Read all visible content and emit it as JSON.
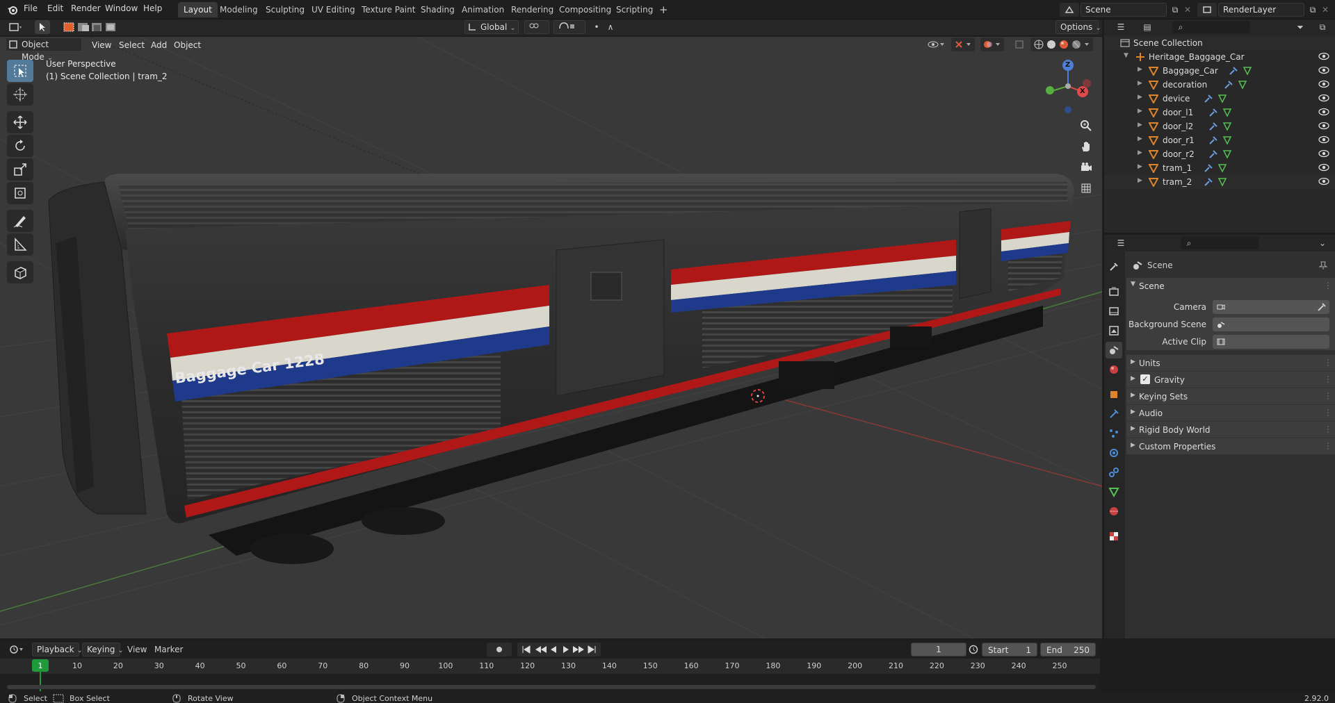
{
  "menus": {
    "file": "File",
    "edit": "Edit",
    "render": "Render",
    "window": "Window",
    "help": "Help"
  },
  "workspaces": [
    "Layout",
    "Modeling",
    "Sculpting",
    "UV Editing",
    "Texture Paint",
    "Shading",
    "Animation",
    "Rendering",
    "Compositing",
    "Scripting"
  ],
  "active_workspace": "Layout",
  "add_workspace": "+",
  "scene_name": "Scene",
  "render_layer": "RenderLayer",
  "toolbar": {
    "orientation": "Global",
    "options": "Options"
  },
  "viewport_header": {
    "mode": "Object Mode",
    "view": "View",
    "select": "Select",
    "add": "Add",
    "object": "Object"
  },
  "viewport_info": {
    "perspective": "User Perspective",
    "collection": "(1) Scene Collection | tram_2"
  },
  "model": {
    "car_label": "Baggage Car 1228"
  },
  "gizmo": {
    "z": "Z",
    "y": "Y",
    "x": "X"
  },
  "outliner": {
    "root": "Scene Collection",
    "collection": "Heritage_Baggage_Car",
    "items": [
      "Baggage_Car",
      "decoration",
      "device",
      "door_l1",
      "door_l2",
      "door_r1",
      "door_r2",
      "tram_1",
      "tram_2"
    ]
  },
  "properties": {
    "title": "Scene",
    "panel": "Scene",
    "camera_label": "Camera",
    "background_label": "Background Scene",
    "clip_label": "Active Clip",
    "sections": [
      "Units",
      "Gravity",
      "Keying Sets",
      "Audio",
      "Rigid Body World",
      "Custom Properties"
    ]
  },
  "timeline": {
    "playback": "Playback",
    "keying": "Keying",
    "view": "View",
    "marker": "Marker",
    "current_frame": "1",
    "start_label": "Start",
    "start": "1",
    "end_label": "End",
    "end": "250",
    "ticks": [
      "1",
      "10",
      "20",
      "30",
      "40",
      "50",
      "60",
      "70",
      "80",
      "90",
      "100",
      "110",
      "120",
      "130",
      "140",
      "150",
      "160",
      "170",
      "180",
      "190",
      "200",
      "210",
      "220",
      "230",
      "240",
      "250"
    ]
  },
  "statusbar": {
    "select": "Select",
    "box_select": "Box Select",
    "rotate": "Rotate View",
    "context": "Object Context Menu",
    "version": "2.92.0"
  },
  "colors": {
    "accent": "#4772b3",
    "active_tool": "#547a9a",
    "stripe_red": "#b01818",
    "stripe_blue": "#1f3a8a",
    "frame_green": "#1f9a3b",
    "object_orange": "#e0832b"
  }
}
